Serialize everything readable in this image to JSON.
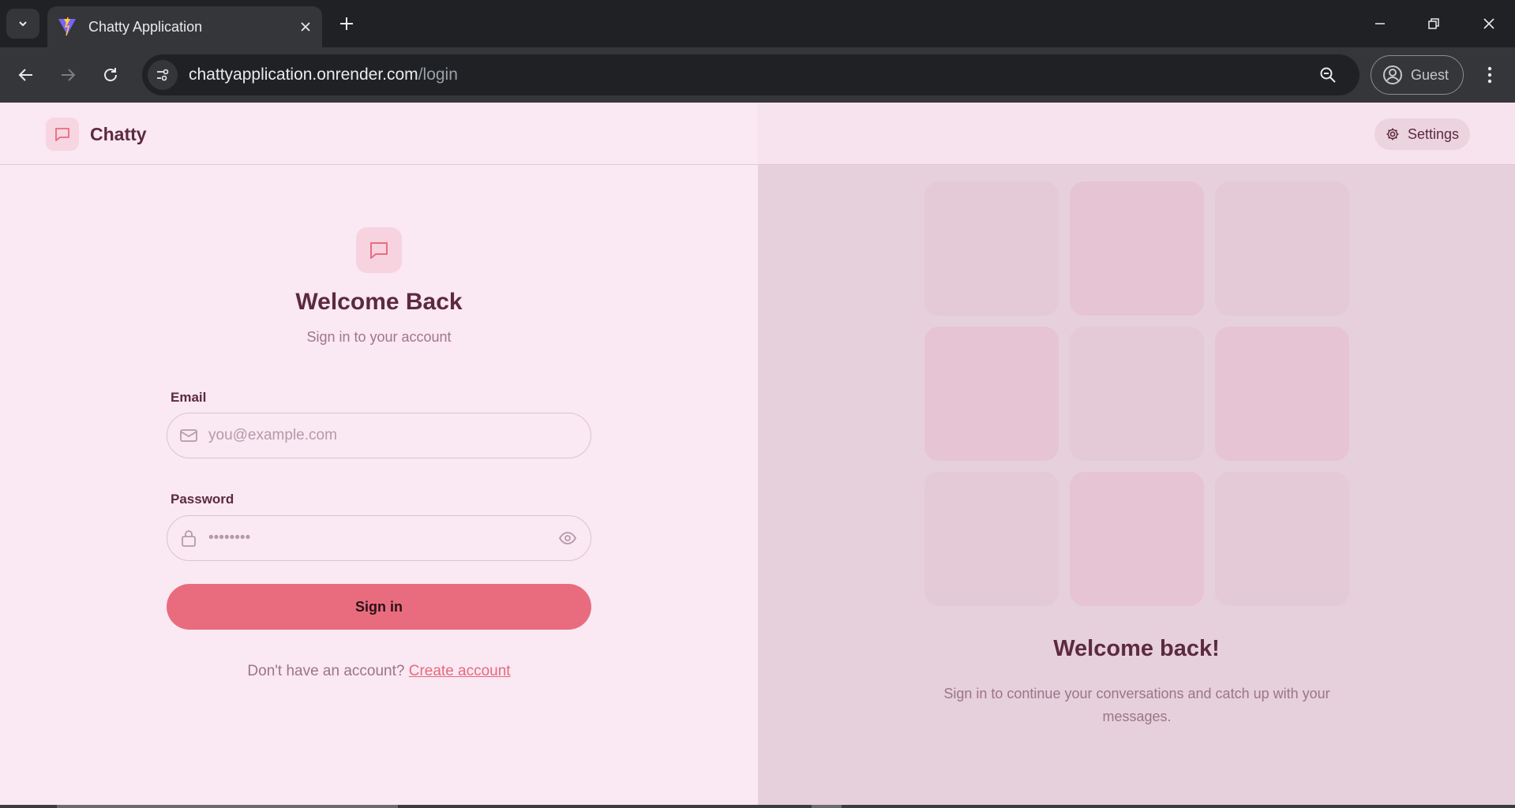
{
  "browser": {
    "tab_title": "Chatty Application",
    "url_host": "chattyapplication.onrender.com",
    "url_path": "/login",
    "profile_label": "Guest"
  },
  "header": {
    "brand": "Chatty",
    "settings_label": "Settings"
  },
  "login": {
    "title": "Welcome Back",
    "subtitle": "Sign in to your account",
    "email_label": "Email",
    "email_placeholder": "you@example.com",
    "password_label": "Password",
    "password_value": "••••••••",
    "submit_label": "Sign in",
    "signup_prompt": "Don't have an account?",
    "signup_link": "Create account"
  },
  "promo": {
    "title": "Welcome back!",
    "subtitle": "Sign in to continue your conversations and catch up with your messages."
  },
  "colors": {
    "accent": "#e96c7e",
    "brand_text": "#5c2a3f",
    "page_bg": "#fae8f3",
    "panel_bg": "#e6d0dc"
  },
  "icons": [
    "chevron-down-icon",
    "favicon",
    "close-icon",
    "plus-icon",
    "minimize-icon",
    "restore-icon",
    "back-icon",
    "forward-icon",
    "reload-icon",
    "site-info-icon",
    "zoom-icon",
    "profile-icon",
    "kebab-menu-icon",
    "chat-bubble-icon",
    "gear-icon",
    "mail-icon",
    "lock-icon",
    "eye-icon"
  ]
}
